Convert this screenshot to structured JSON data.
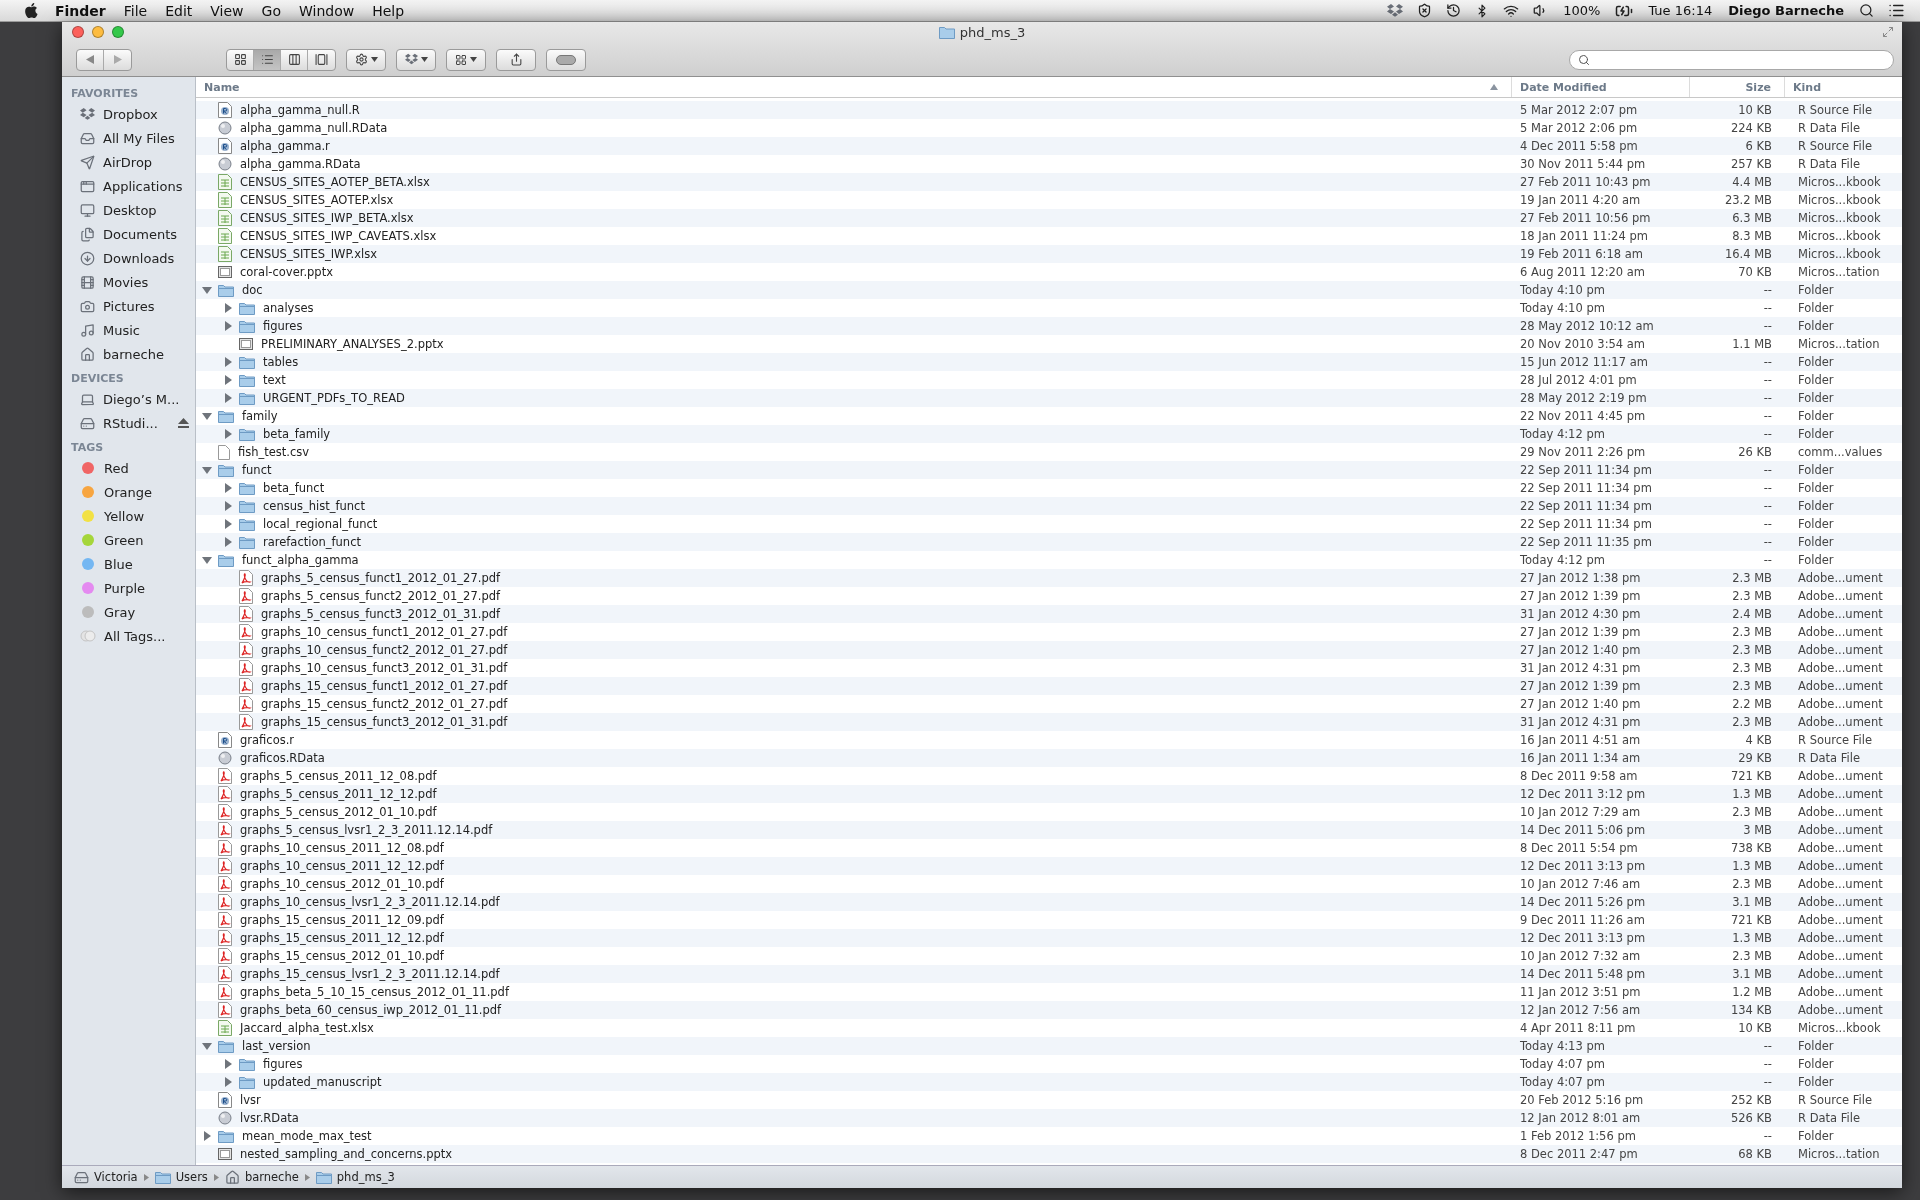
{
  "menubar": {
    "app": "Finder",
    "menus": [
      "File",
      "Edit",
      "View",
      "Go",
      "Window",
      "Help"
    ],
    "battery": "100%",
    "clock": "Tue 16:14",
    "user": "Diego Barneche"
  },
  "window": {
    "title": "phd_ms_3",
    "view_modes": [
      {
        "kind": "icons",
        "selected": false
      },
      {
        "kind": "list",
        "selected": true
      },
      {
        "kind": "columns",
        "selected": false
      },
      {
        "kind": "coverflow",
        "selected": false
      }
    ]
  },
  "sidebar": {
    "sections": [
      {
        "title": "FAVORITES",
        "items": [
          {
            "label": "Dropbox"
          },
          {
            "label": "All My Files"
          },
          {
            "label": "AirDrop"
          },
          {
            "label": "Applications"
          },
          {
            "label": "Desktop"
          },
          {
            "label": "Documents"
          },
          {
            "label": "Downloads"
          },
          {
            "label": "Movies"
          },
          {
            "label": "Pictures"
          },
          {
            "label": "Music"
          },
          {
            "label": "barneche"
          }
        ]
      },
      {
        "title": "DEVICES",
        "items": [
          {
            "label": "Diego’s M...",
            "eject": false
          },
          {
            "label": "RStudi...",
            "eject": true
          }
        ]
      },
      {
        "title": "TAGS",
        "items": [
          {
            "label": "Red",
            "color": "#f06565"
          },
          {
            "label": "Orange",
            "color": "#f7a540"
          },
          {
            "label": "Yellow",
            "color": "#f2e144"
          },
          {
            "label": "Green",
            "color": "#a5d63a"
          },
          {
            "label": "Blue",
            "color": "#74b7f2"
          },
          {
            "label": "Purple",
            "color": "#e48af0"
          },
          {
            "label": "Gray",
            "color": "#bcbcbc"
          },
          {
            "label": "All Tags..."
          }
        ]
      }
    ]
  },
  "columns": [
    "Name",
    "Date Modified",
    "Size",
    "Kind"
  ],
  "rows": [
    {
      "name": "alpha_gamma_null.R",
      "kind": "r-source",
      "date": "5 Mar 2012 2:07 pm",
      "size": "10 KB",
      "file_kind": "R Source File"
    },
    {
      "name": "alpha_gamma_null.RData",
      "kind": "r-data",
      "date": "5 Mar 2012 2:06 pm",
      "size": "224 KB",
      "file_kind": "R Data File"
    },
    {
      "name": "alpha_gamma.r",
      "kind": "r-source",
      "date": "4 Dec 2011 5:58 pm",
      "size": "6 KB",
      "file_kind": "R Source File"
    },
    {
      "name": "alpha_gamma.RData",
      "kind": "r-data",
      "date": "30 Nov 2011 5:44 pm",
      "size": "257 KB",
      "file_kind": "R Data File"
    },
    {
      "name": "CENSUS_SITES_AOTEP_BETA.xlsx",
      "kind": "excel",
      "date": "27 Feb 2011 10:43 pm",
      "size": "4.4 MB",
      "file_kind": "Micros...kbook"
    },
    {
      "name": "CENSUS_SITES_AOTEP.xlsx",
      "kind": "excel",
      "date": "19 Jan 2011 4:20 am",
      "size": "23.2 MB",
      "file_kind": "Micros...kbook"
    },
    {
      "name": "CENSUS_SITES_IWP_BETA.xlsx",
      "kind": "excel",
      "date": "27 Feb 2011 10:56 pm",
      "size": "6.3 MB",
      "file_kind": "Micros...kbook"
    },
    {
      "name": "CENSUS_SITES_IWP_CAVEATS.xlsx",
      "kind": "excel",
      "date": "18 Jan 2011 11:24 pm",
      "size": "8.3 MB",
      "file_kind": "Micros...kbook"
    },
    {
      "name": "CENSUS_SITES_IWP.xlsx",
      "kind": "excel",
      "date": "19 Feb 2011 6:18 am",
      "size": "16.4 MB",
      "file_kind": "Micros...kbook"
    },
    {
      "name": "coral-cover.pptx",
      "kind": "ppt",
      "date": "6 Aug 2011 12:20 am",
      "size": "70 KB",
      "file_kind": "Micros...tation"
    },
    {
      "name": "doc",
      "kind": "folder",
      "expanded": true,
      "date": "Today 4:10 pm",
      "size": "--",
      "file_kind": "Folder",
      "children": [
        {
          "name": "analyses",
          "kind": "folder",
          "expanded": false,
          "date": "Today 4:10 pm",
          "size": "--",
          "file_kind": "Folder"
        },
        {
          "name": "figures",
          "kind": "folder",
          "expanded": false,
          "date": "28 May 2012 10:12 am",
          "size": "--",
          "file_kind": "Folder"
        },
        {
          "name": "PRELIMINARY_ANALYSES_2.pptx",
          "kind": "ppt",
          "date": "20 Nov 2010 3:54 am",
          "size": "1.1 MB",
          "file_kind": "Micros...tation"
        },
        {
          "name": "tables",
          "kind": "folder",
          "expanded": false,
          "date": "15 Jun 2012 11:17 am",
          "size": "--",
          "file_kind": "Folder"
        },
        {
          "name": "text",
          "kind": "folder",
          "expanded": false,
          "date": "28 Jul 2012 4:01 pm",
          "size": "--",
          "file_kind": "Folder"
        },
        {
          "name": "URGENT_PDFs_TO_READ",
          "kind": "folder",
          "expanded": false,
          "date": "28 May 2012 2:19 pm",
          "size": "--",
          "file_kind": "Folder"
        }
      ]
    },
    {
      "name": "family",
      "kind": "folder",
      "expanded": true,
      "date": "22 Nov 2011 4:45 pm",
      "size": "--",
      "file_kind": "Folder",
      "children": [
        {
          "name": "beta_family",
          "kind": "folder",
          "expanded": false,
          "date": "Today 4:12 pm",
          "size": "--",
          "file_kind": "Folder"
        }
      ]
    },
    {
      "name": "fish_test.csv",
      "kind": "csv",
      "date": "29 Nov 2011 2:26 pm",
      "size": "26 KB",
      "file_kind": "comm...values"
    },
    {
      "name": "funct",
      "kind": "folder",
      "expanded": true,
      "date": "22 Sep 2011 11:34 pm",
      "size": "--",
      "file_kind": "Folder",
      "children": [
        {
          "name": "beta_funct",
          "kind": "folder",
          "expanded": false,
          "date": "22 Sep 2011 11:34 pm",
          "size": "--",
          "file_kind": "Folder"
        },
        {
          "name": "census_hist_funct",
          "kind": "folder",
          "expanded": false,
          "date": "22 Sep 2011 11:34 pm",
          "size": "--",
          "file_kind": "Folder"
        },
        {
          "name": "local_regional_funct",
          "kind": "folder",
          "expanded": false,
          "date": "22 Sep 2011 11:34 pm",
          "size": "--",
          "file_kind": "Folder"
        },
        {
          "name": "rarefaction_funct",
          "kind": "folder",
          "expanded": false,
          "date": "22 Sep 2011 11:35 pm",
          "size": "--",
          "file_kind": "Folder"
        }
      ]
    },
    {
      "name": "funct_alpha_gamma",
      "kind": "folder",
      "expanded": true,
      "date": "Today 4:12 pm",
      "size": "--",
      "file_kind": "Folder",
      "children": [
        {
          "name": "graphs_5_census_funct1_2012_01_27.pdf",
          "kind": "pdf",
          "date": "27 Jan 2012 1:38 pm",
          "size": "2.3 MB",
          "file_kind": "Adobe...ument"
        },
        {
          "name": "graphs_5_census_funct2_2012_01_27.pdf",
          "kind": "pdf",
          "date": "27 Jan 2012 1:39 pm",
          "size": "2.3 MB",
          "file_kind": "Adobe...ument"
        },
        {
          "name": "graphs_5_census_funct3_2012_01_31.pdf",
          "kind": "pdf",
          "date": "31 Jan 2012 4:30 pm",
          "size": "2.4 MB",
          "file_kind": "Adobe...ument"
        },
        {
          "name": "graphs_10_census_funct1_2012_01_27.pdf",
          "kind": "pdf",
          "date": "27 Jan 2012 1:39 pm",
          "size": "2.3 MB",
          "file_kind": "Adobe...ument"
        },
        {
          "name": "graphs_10_census_funct2_2012_01_27.pdf",
          "kind": "pdf",
          "date": "27 Jan 2012 1:40 pm",
          "size": "2.3 MB",
          "file_kind": "Adobe...ument"
        },
        {
          "name": "graphs_10_census_funct3_2012_01_31.pdf",
          "kind": "pdf",
          "date": "31 Jan 2012 4:31 pm",
          "size": "2.3 MB",
          "file_kind": "Adobe...ument"
        },
        {
          "name": "graphs_15_census_funct1_2012_01_27.pdf",
          "kind": "pdf",
          "date": "27 Jan 2012 1:39 pm",
          "size": "2.3 MB",
          "file_kind": "Adobe...ument"
        },
        {
          "name": "graphs_15_census_funct2_2012_01_27.pdf",
          "kind": "pdf",
          "date": "27 Jan 2012 1:40 pm",
          "size": "2.2 MB",
          "file_kind": "Adobe...ument"
        },
        {
          "name": "graphs_15_census_funct3_2012_01_31.pdf",
          "kind": "pdf",
          "date": "31 Jan 2012 4:31 pm",
          "size": "2.3 MB",
          "file_kind": "Adobe...ument"
        }
      ]
    },
    {
      "name": "graficos.r",
      "kind": "r-source",
      "date": "16 Jan 2011 4:51 am",
      "size": "4 KB",
      "file_kind": "R Source File"
    },
    {
      "name": "graficos.RData",
      "kind": "r-data",
      "date": "16 Jan 2011 1:34 am",
      "size": "29 KB",
      "file_kind": "R Data File"
    },
    {
      "name": "graphs_5_census_2011_12_08.pdf",
      "kind": "pdf",
      "date": "8 Dec 2011 9:58 am",
      "size": "721 KB",
      "file_kind": "Adobe...ument"
    },
    {
      "name": "graphs_5_census_2011_12_12.pdf",
      "kind": "pdf",
      "date": "12 Dec 2011 3:12 pm",
      "size": "1.3 MB",
      "file_kind": "Adobe...ument"
    },
    {
      "name": "graphs_5_census_2012_01_10.pdf",
      "kind": "pdf",
      "date": "10 Jan 2012 7:29 am",
      "size": "2.3 MB",
      "file_kind": "Adobe...ument"
    },
    {
      "name": "graphs_5_census_lvsr1_2_3_2011.12.14.pdf",
      "kind": "pdf",
      "date": "14 Dec 2011 5:06 pm",
      "size": "3 MB",
      "file_kind": "Adobe...ument"
    },
    {
      "name": "graphs_10_census_2011_12_08.pdf",
      "kind": "pdf",
      "date": "8 Dec 2011 5:54 pm",
      "size": "738 KB",
      "file_kind": "Adobe...ument"
    },
    {
      "name": "graphs_10_census_2011_12_12.pdf",
      "kind": "pdf",
      "date": "12 Dec 2011 3:13 pm",
      "size": "1.3 MB",
      "file_kind": "Adobe...ument"
    },
    {
      "name": "graphs_10_census_2012_01_10.pdf",
      "kind": "pdf",
      "date": "10 Jan 2012 7:46 am",
      "size": "2.3 MB",
      "file_kind": "Adobe...ument"
    },
    {
      "name": "graphs_10_census_lvsr1_2_3_2011.12.14.pdf",
      "kind": "pdf",
      "date": "14 Dec 2011 5:26 pm",
      "size": "3.1 MB",
      "file_kind": "Adobe...ument"
    },
    {
      "name": "graphs_15_census_2011_12_09.pdf",
      "kind": "pdf",
      "date": "9 Dec 2011 11:26 am",
      "size": "721 KB",
      "file_kind": "Adobe...ument"
    },
    {
      "name": "graphs_15_census_2011_12_12.pdf",
      "kind": "pdf",
      "date": "12 Dec 2011 3:13 pm",
      "size": "1.3 MB",
      "file_kind": "Adobe...ument"
    },
    {
      "name": "graphs_15_census_2012_01_10.pdf",
      "kind": "pdf",
      "date": "10 Jan 2012 7:32 am",
      "size": "2.3 MB",
      "file_kind": "Adobe...ument"
    },
    {
      "name": "graphs_15_census_lvsr1_2_3_2011.12.14.pdf",
      "kind": "pdf",
      "date": "14 Dec 2011 5:48 pm",
      "size": "3.1 MB",
      "file_kind": "Adobe...ument"
    },
    {
      "name": "graphs_beta_5_10_15_census_2012_01_11.pdf",
      "kind": "pdf",
      "date": "11 Jan 2012 3:51 pm",
      "size": "1.2 MB",
      "file_kind": "Adobe...ument"
    },
    {
      "name": "graphs_beta_60_census_iwp_2012_01_11.pdf",
      "kind": "pdf",
      "date": "12 Jan 2012 7:56 am",
      "size": "134 KB",
      "file_kind": "Adobe...ument"
    },
    {
      "name": "Jaccard_alpha_test.xlsx",
      "kind": "excel",
      "date": "4 Apr 2011 8:11 pm",
      "size": "10 KB",
      "file_kind": "Micros...kbook"
    },
    {
      "name": "last_version",
      "kind": "folder",
      "expanded": true,
      "date": "Today 4:13 pm",
      "size": "--",
      "file_kind": "Folder",
      "children": [
        {
          "name": "figures",
          "kind": "folder",
          "expanded": false,
          "date": "Today 4:07 pm",
          "size": "--",
          "file_kind": "Folder"
        },
        {
          "name": "updated_manuscript",
          "kind": "folder",
          "expanded": false,
          "date": "Today 4:07 pm",
          "size": "--",
          "file_kind": "Folder"
        }
      ]
    },
    {
      "name": "lvsr",
      "kind": "r-source",
      "date": "20 Feb 2012 5:16 pm",
      "size": "252 KB",
      "file_kind": "R Source File"
    },
    {
      "name": "lvsr.RData",
      "kind": "r-data",
      "date": "12 Jan 2012 8:01 am",
      "size": "526 KB",
      "file_kind": "R Data File"
    },
    {
      "name": "mean_mode_max_test",
      "kind": "folder",
      "expanded": false,
      "date": "1 Feb 2012 1:56 pm",
      "size": "--",
      "file_kind": "Folder"
    },
    {
      "name": "nested_sampling_and_concerns.pptx",
      "kind": "ppt",
      "date": "8 Dec 2011 2:47 pm",
      "size": "68 KB",
      "file_kind": "Micros...tation"
    }
  ],
  "path_bar": [
    {
      "label": "Victoria",
      "kind": "disk"
    },
    {
      "label": "Users",
      "kind": "folder"
    },
    {
      "label": "barneche",
      "kind": "home"
    },
    {
      "label": "phd_ms_3",
      "kind": "folder"
    }
  ]
}
